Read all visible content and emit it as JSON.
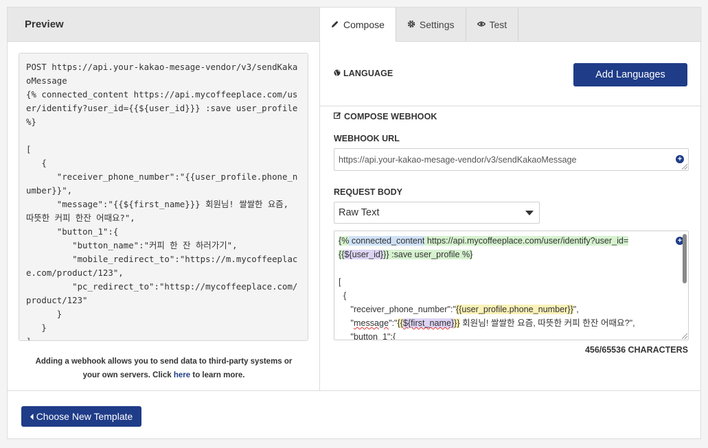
{
  "preview": {
    "title": "Preview",
    "code": "POST https://api.your-kakao-mesage-vendor/v3/sendKakaoMessage\n{% connected_content https://api.mycoffeeplace.com/user/identify?user_id={{${user_id}}} :save user_profile %}\n\n[\n   {\n      \"receiver_phone_number\":\"{{user_profile.phone_number}}\",\n      \"message\":\"{{${first_name}}} 회원님! 쌀쌀한 요즘, 따뜻한 커피 한잔 어때요?\",\n      \"button_1\":{\n         \"button_name\":\"커피 한 잔 하러가기\",\n         \"mobile_redirect_to\":\"https://m.mycoffeeplace.com/product/123\",\n         \"pc_redirect_to\":\"httsp://mycoffeeplace.com/product/123\"\n      }\n   }\n]",
    "note_before": "Adding a webhook allows you to send data to third-party systems or your own servers. Click ",
    "note_link": "here",
    "note_after": " to learn more."
  },
  "tabs": [
    {
      "label": "Compose",
      "icon": "pencil-icon",
      "active": true
    },
    {
      "label": "Settings",
      "icon": "gear-icon",
      "active": false
    },
    {
      "label": "Test",
      "icon": "eye-icon",
      "active": false
    }
  ],
  "language": {
    "label": "LANGUAGE",
    "icon": "globe-icon",
    "add_button": "Add Languages"
  },
  "compose": {
    "label": "COMPOSE WEBHOOK",
    "icon": "edit-icon",
    "url_label": "WEBHOOK URL",
    "url_value": "https://api.your-kakao-mesage-vendor/v3/sendKakaoMessage",
    "body_label": "REQUEST BODY",
    "body_format": "Raw Text",
    "body_lines": {
      "l1_a": "{%",
      "l1_b": " connected_content",
      "l1_c": " https://api.mycoffeeplace.com/user/identify?user_id=",
      "l2_a": "{{",
      "l2_b": "${user_id}",
      "l2_c": "}}",
      "l2_d": " :save user_profile %}",
      "l4": "[",
      "l5": "  {",
      "l6_a": "     \"receiver_phone_number\":\"",
      "l6_b": "{{user_profile.phone_number}}",
      "l6_c": "\",",
      "l7_a": "     \"",
      "l7_b": "message",
      "l7_c": "\":\"",
      "l7_d": "{{",
      "l7_e": "${first_name}",
      "l7_f": "}}",
      "l7_g": " 회원님! 쌀쌀한 요즘, 따뜻한 커피 한잔 어때요?\",",
      "l8": "     \"button_1\":{"
    },
    "char_count": "456/65536 CHARACTERS"
  },
  "footer": {
    "choose_button": "Choose New Template"
  },
  "colors": {
    "accent": "#1f3c88"
  }
}
